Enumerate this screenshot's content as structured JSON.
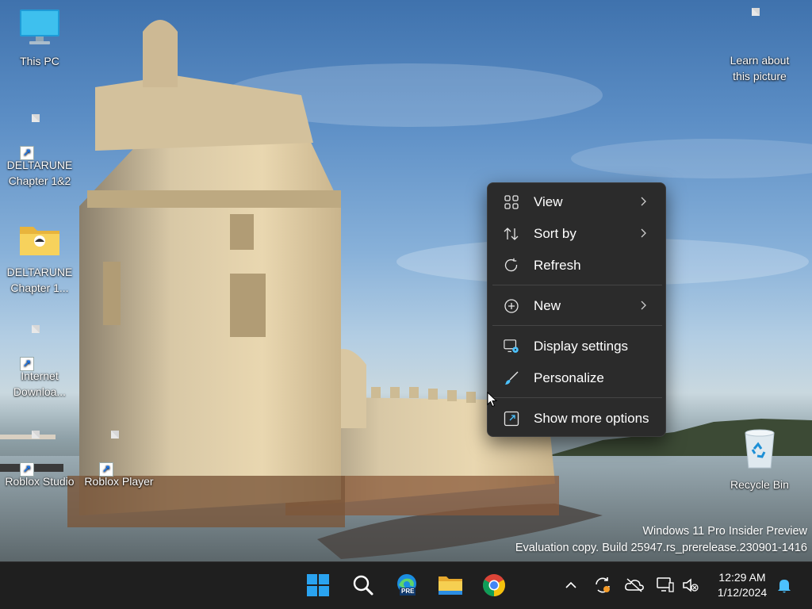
{
  "desktop": {
    "icons": [
      {
        "label": "This PC"
      },
      {
        "label": "DELTARUNE Chapter 1&2"
      },
      {
        "label": "DELTARUNE Chapter 1..."
      },
      {
        "label": "Internet Downloa..."
      },
      {
        "label": "Roblox Studio"
      },
      {
        "label": "Roblox Player"
      },
      {
        "label": "Learn about this picture"
      },
      {
        "label": "Recycle Bin"
      }
    ],
    "watermark": {
      "line1": "Windows 11 Pro Insider Preview",
      "line2": "Evaluation copy. Build 25947.rs_prerelease.230901-1416"
    }
  },
  "context_menu": {
    "items": [
      {
        "label": "View",
        "icon": "grid-icon",
        "submenu": true
      },
      {
        "label": "Sort by",
        "icon": "sort-arrows-icon",
        "submenu": true
      },
      {
        "label": "Refresh",
        "icon": "refresh-icon",
        "submenu": false
      },
      {
        "label": "New",
        "icon": "plus-circle-icon",
        "submenu": true
      },
      {
        "label": "Display settings",
        "icon": "display-settings-icon",
        "submenu": false
      },
      {
        "label": "Personalize",
        "icon": "brush-icon",
        "submenu": false
      },
      {
        "label": "Show more options",
        "icon": "open-external-icon",
        "submenu": false
      }
    ]
  },
  "taskbar": {
    "apps": [
      "windows-start-icon",
      "search-icon",
      "edge-pre-icon",
      "file-explorer-icon",
      "chrome-icon"
    ],
    "edge_badge": "PRE",
    "tray": [
      "chevron-up-icon",
      "sync-icon",
      "onedrive-off-icon",
      "network-icon",
      "volume-muted-icon"
    ],
    "time": "12:29 AM",
    "date": "1/12/2024"
  },
  "colors": {
    "menu_bg": "#2b2b2b",
    "taskbar_bg": "#1f1f1f",
    "accent": "#4cc2ff"
  }
}
